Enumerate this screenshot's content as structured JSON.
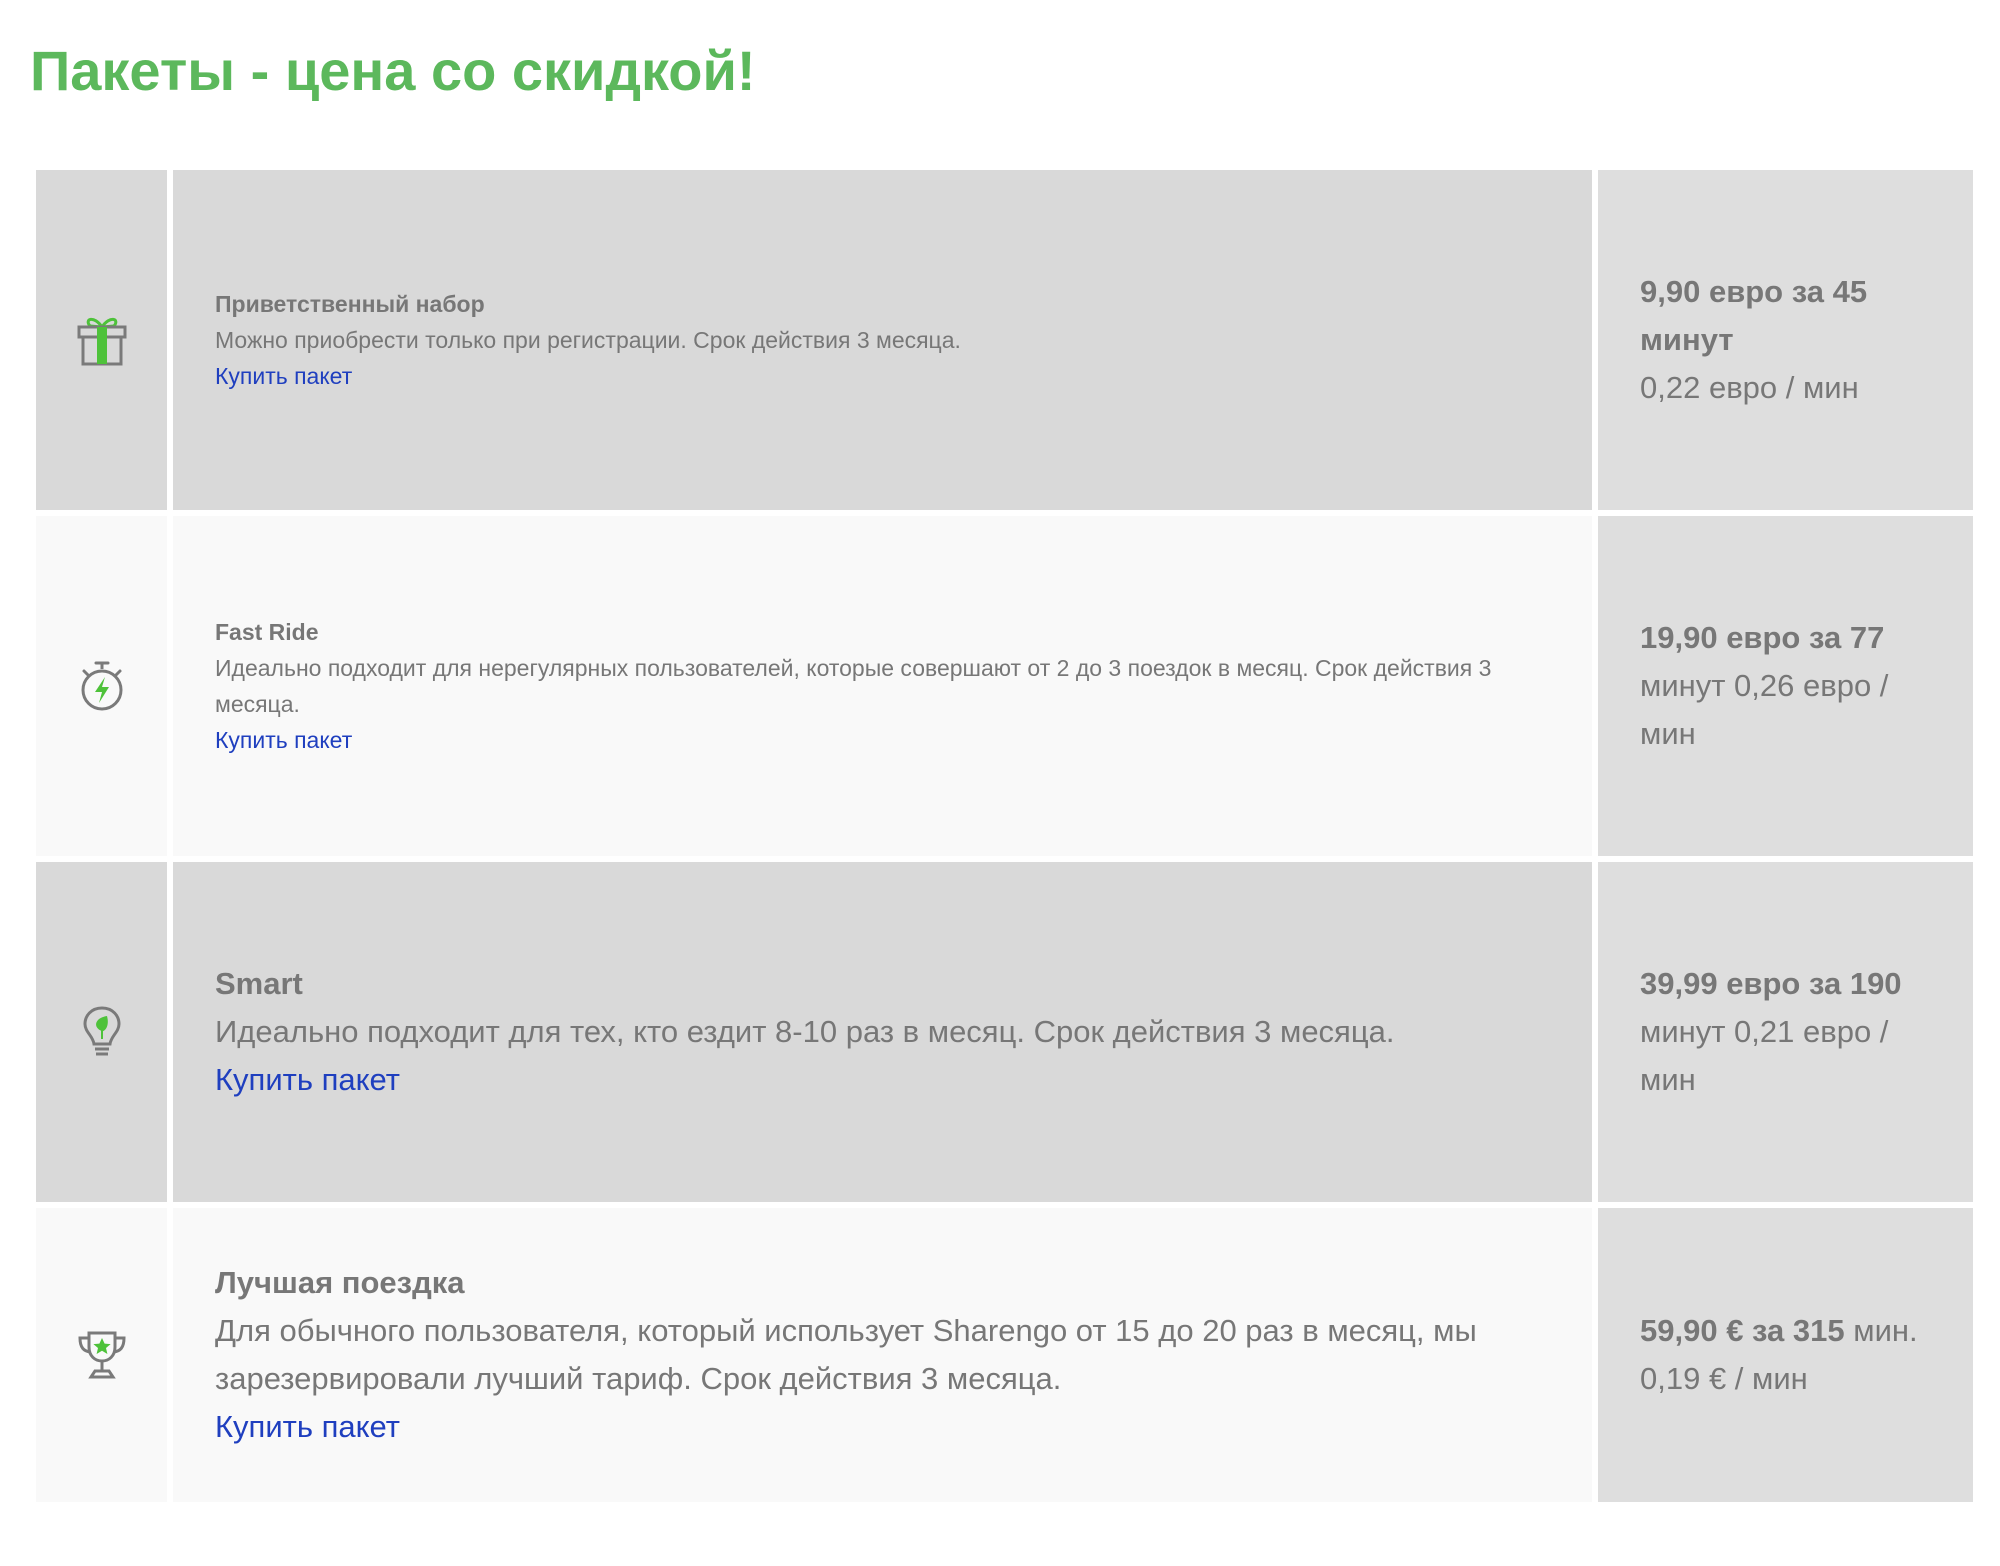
{
  "page": {
    "title": "Пакеты - цена со скидкой!"
  },
  "colors": {
    "title_green": "#5cb85c",
    "icon_green": "#4ec23a",
    "icon_gray": "#7a7a7a",
    "link_blue": "#1f3fbf",
    "row_dark": "#d9d9d9",
    "row_light": "#f9f9f9",
    "price_bg": "#dedede"
  },
  "packages": [
    {
      "icon": "gift-icon",
      "title": "Приветственный набор",
      "description": "Можно приобрести только при регистрации. Срок действия 3 месяца.",
      "link": "Купить пакет",
      "price_bold": "9,90 евро за 45 минут",
      "price_rest": "0,22 евро / мин"
    },
    {
      "icon": "stopwatch-icon",
      "title": "Fast Ride",
      "description": "Идеально подходит для нерегулярных пользователей, которые совершают от 2 до 3 поездок в месяц. Срок действия 3 месяца.",
      "link": "Купить пакет",
      "price_bold": "19,90 евро за 77",
      "price_rest": "минут 0,26 евро / мин"
    },
    {
      "icon": "lightbulb-icon",
      "title": "Smart",
      "description": "Идеально подходит для тех, кто ездит 8-10 раз в месяц. Срок действия 3 месяца.",
      "link": "Купить пакет",
      "price_bold": "39,99 евро за 190",
      "price_rest": "минут 0,21 евро / мин"
    },
    {
      "icon": "trophy-icon",
      "title": "Лучшая поездка",
      "description": "Для обычного пользователя, который использует Sharengo от 15 до 20 раз в месяц, мы зарезервировали лучший тариф. Срок действия 3 месяца.",
      "link": "Купить пакет",
      "price_bold": "59,90 € за 315",
      "price_rest": "мин. 0,19 € / мин"
    }
  ]
}
